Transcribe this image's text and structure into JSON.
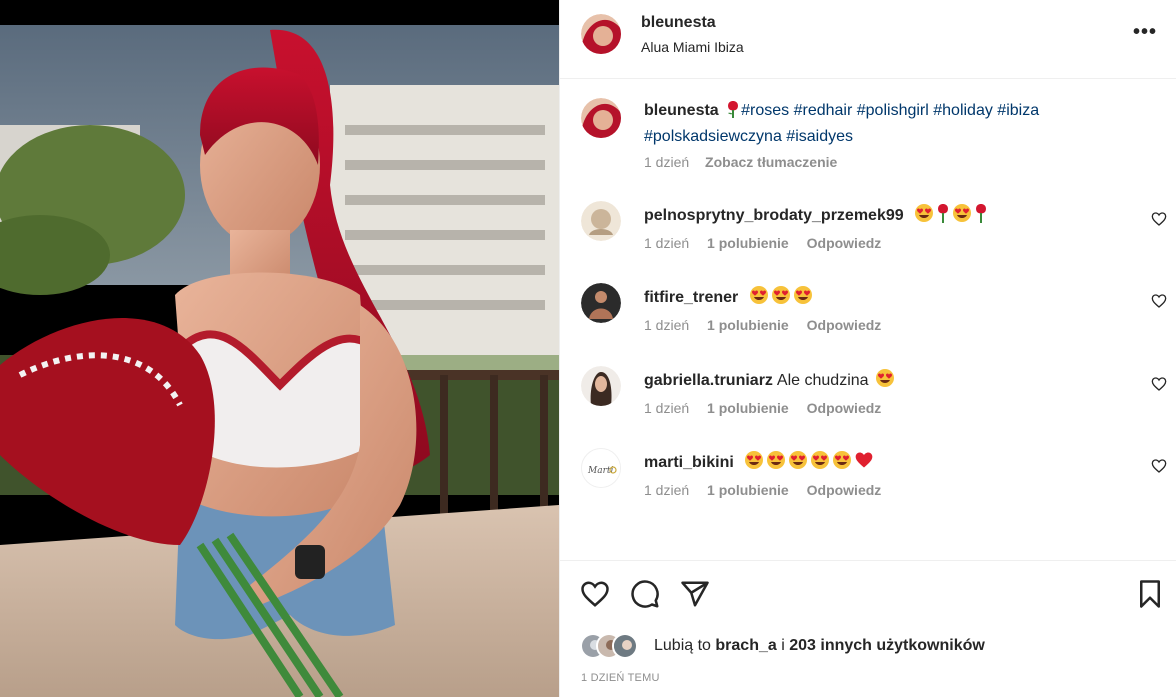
{
  "post": {
    "username": "bleunesta",
    "location": "Alua Miami Ibiza",
    "more_label": "•••"
  },
  "caption": {
    "username": "bleunesta",
    "text": "#roses #redhair #polishgirl #holiday #ibiza #polskadsiewczyna #isaidyes",
    "emoji": "rose-emoji",
    "age": "1 dzień",
    "translate_label": "Zobacz tłumaczenie"
  },
  "comments": [
    {
      "username": "pelnosprytny_brodaty_przemek99",
      "text": "",
      "emojis": [
        "heart-eyes",
        "rose",
        "heart-eyes",
        "rose"
      ],
      "age": "1 dzień",
      "likes": "1 polubienie",
      "reply": "Odpowiedz"
    },
    {
      "username": "fitfire_trener",
      "text": "",
      "emojis": [
        "heart-eyes",
        "heart-eyes",
        "heart-eyes"
      ],
      "age": "1 dzień",
      "likes": "1 polubienie",
      "reply": "Odpowiedz"
    },
    {
      "username": "gabriella.truniarz",
      "text": "Ale chudzina",
      "emojis": [
        "heart-eyes"
      ],
      "age": "1 dzień",
      "likes": "1 polubienie",
      "reply": "Odpowiedz"
    },
    {
      "username": "marti_bikini",
      "text": "",
      "emojis": [
        "heart-eyes",
        "heart-eyes",
        "heart-eyes",
        "heart-eyes",
        "heart-eyes",
        "red-heart"
      ],
      "age": "1 dzień",
      "likes": "1 polubienie",
      "reply": "Odpowiedz"
    }
  ],
  "likes": {
    "prefix": "Lubią to",
    "first_user": "brach_a",
    "connector": "i",
    "others": "203 innych użytkowników"
  },
  "timestamp": "1 DZIEŃ TEMU",
  "colors": {
    "hashtag": "#00376b",
    "secondary_text": "#8e8e8e",
    "primary_text": "#262626",
    "divider": "#efefef"
  }
}
